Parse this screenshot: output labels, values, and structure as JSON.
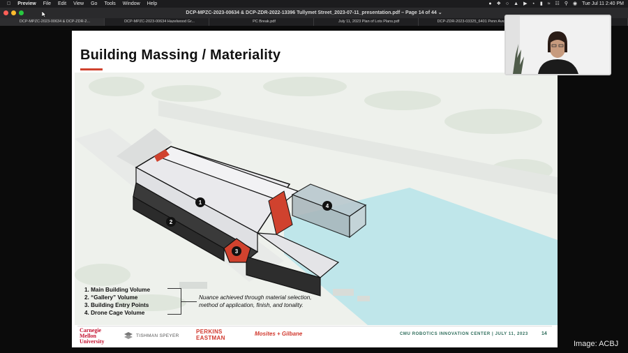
{
  "menubar": {
    "app": "Preview",
    "items": [
      "File",
      "Edit",
      "View",
      "Go",
      "Tools",
      "Window",
      "Help"
    ],
    "clock": "Tue Jul 11  2:40 PM"
  },
  "window": {
    "title": "DCP-MPZC-2023-00634 & DCP-ZDR-2022-13396 Tullymet Street_2023-07-11_presentation.pdf – Page 14 of 44 ⌄"
  },
  "tabs": [
    {
      "label": "DCP-MPZC-2023-00634 & DCP-ZDR-2...",
      "active": true
    },
    {
      "label": "DCP-MPZC-2023-00634 Hazelwood Gr..."
    },
    {
      "label": "PC Break.pdf"
    },
    {
      "label": "July 11, 2023 Plan of Lots Plans.pdf"
    },
    {
      "label": "DCP-ZDR-2023-03325_6401 Penn Ave_..."
    },
    {
      "label": "DCP-ZDR-2022-18515_293..."
    }
  ],
  "slide": {
    "title": "Building Massing / Materiality",
    "legend": [
      "1. Main Building Volume",
      "2. “Gallery” Volume",
      "3. Building Entry Points",
      "4. Drone Cage Volume"
    ],
    "note_line1": "Nuance achieved through material selection,",
    "note_line2": "method of application, finish, and tonality.",
    "markers": [
      "1",
      "2",
      "3",
      "4"
    ],
    "logos": {
      "cmu_1": "Carnegie",
      "cmu_2": "Mellon",
      "cmu_3": "University",
      "tishman": "TISHMAN SPEYER",
      "perkins_1": "PERKINS",
      "perkins_2": "EASTMAN",
      "mosites": "Mosites + Gilbane"
    },
    "footer": "CMU ROBOTICS INNOVATION CENTER   |   JULY 11, 2023",
    "page": "14"
  },
  "watermark": "Image: ACBJ",
  "colors": {
    "accent_red": "#d0422e",
    "footer_green": "#2a6a58",
    "water": "#bfe6ea"
  }
}
